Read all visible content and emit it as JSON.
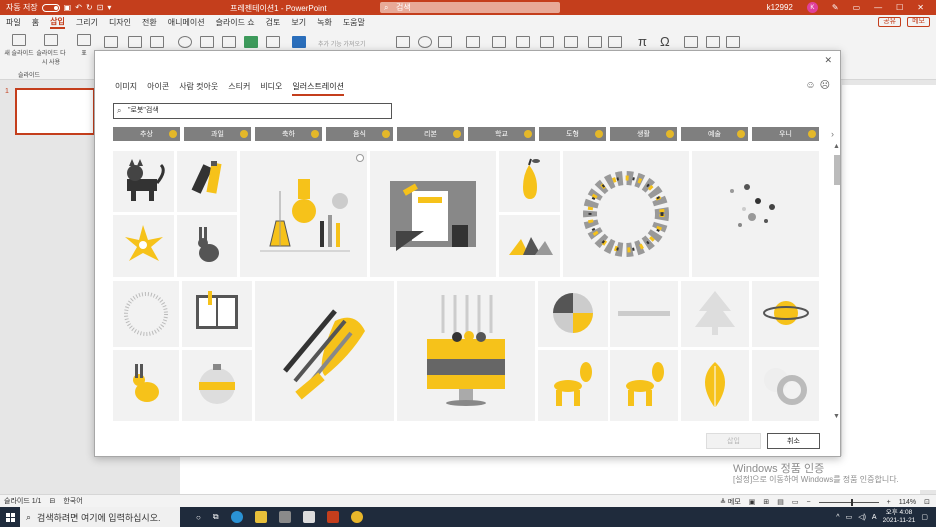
{
  "titlebar": {
    "autosave_label": "자동 저장",
    "autosave_state": "끔",
    "doc_title": "프레젠테이션1 - PowerPoint",
    "search_placeholder": "검색",
    "user_name": "k12992",
    "user_initial": "K"
  },
  "menubar": {
    "tabs": [
      {
        "label": "파일"
      },
      {
        "label": "홈"
      },
      {
        "label": "삽입"
      },
      {
        "label": "그리기"
      },
      {
        "label": "디자인"
      },
      {
        "label": "전환"
      },
      {
        "label": "애니메이션"
      },
      {
        "label": "슬라이드 쇼"
      },
      {
        "label": "검토"
      },
      {
        "label": "보기"
      },
      {
        "label": "녹화"
      },
      {
        "label": "도움말"
      }
    ],
    "active_tab": "삽입",
    "share_label": "공유",
    "comments_label": "메모"
  },
  "ribbon": {
    "new_slide_label": "새 슬라이드",
    "reuse_slide_label": "슬라이드 다시 사용",
    "slides_group_label": "슬라이드",
    "table_label": "표",
    "addins_label": "추가 기능 가져오기"
  },
  "thumbpane": {
    "slide_number": "1"
  },
  "dialog": {
    "tabs": [
      {
        "label": "이미지"
      },
      {
        "label": "아이콘"
      },
      {
        "label": "사람 컷아웃"
      },
      {
        "label": "스티커"
      },
      {
        "label": "비디오"
      },
      {
        "label": "일러스트레이션"
      }
    ],
    "active_tab": "일러스트레이션",
    "search_value": "\"로봇\"검색",
    "categories": [
      {
        "label": "추상"
      },
      {
        "label": "과일"
      },
      {
        "label": "축하"
      },
      {
        "label": "음식"
      },
      {
        "label": "리본"
      },
      {
        "label": "학교"
      },
      {
        "label": "도형"
      },
      {
        "label": "생활"
      },
      {
        "label": "예술"
      },
      {
        "label": "우니"
      }
    ],
    "insert_label": "삽입",
    "cancel_label": "취소"
  },
  "watermark": {
    "line1": "Windows 정품 인증",
    "line2": "[설정]으로 이동하여 Windows를 정품 인증합니다."
  },
  "statusbar": {
    "slide_info": "슬라이드 1/1",
    "language": "한국어",
    "notes_label": "메모",
    "zoom": "114%"
  },
  "taskbar": {
    "search_placeholder": "검색하려면 여기에 입력하십시오.",
    "time": "오후 4:08",
    "date": "2021-11-21",
    "ime": "A"
  },
  "colors": {
    "accent": "#c43e1c",
    "category_bg": "#7f7f7f",
    "illustration_yellow": "#f6c21a"
  }
}
